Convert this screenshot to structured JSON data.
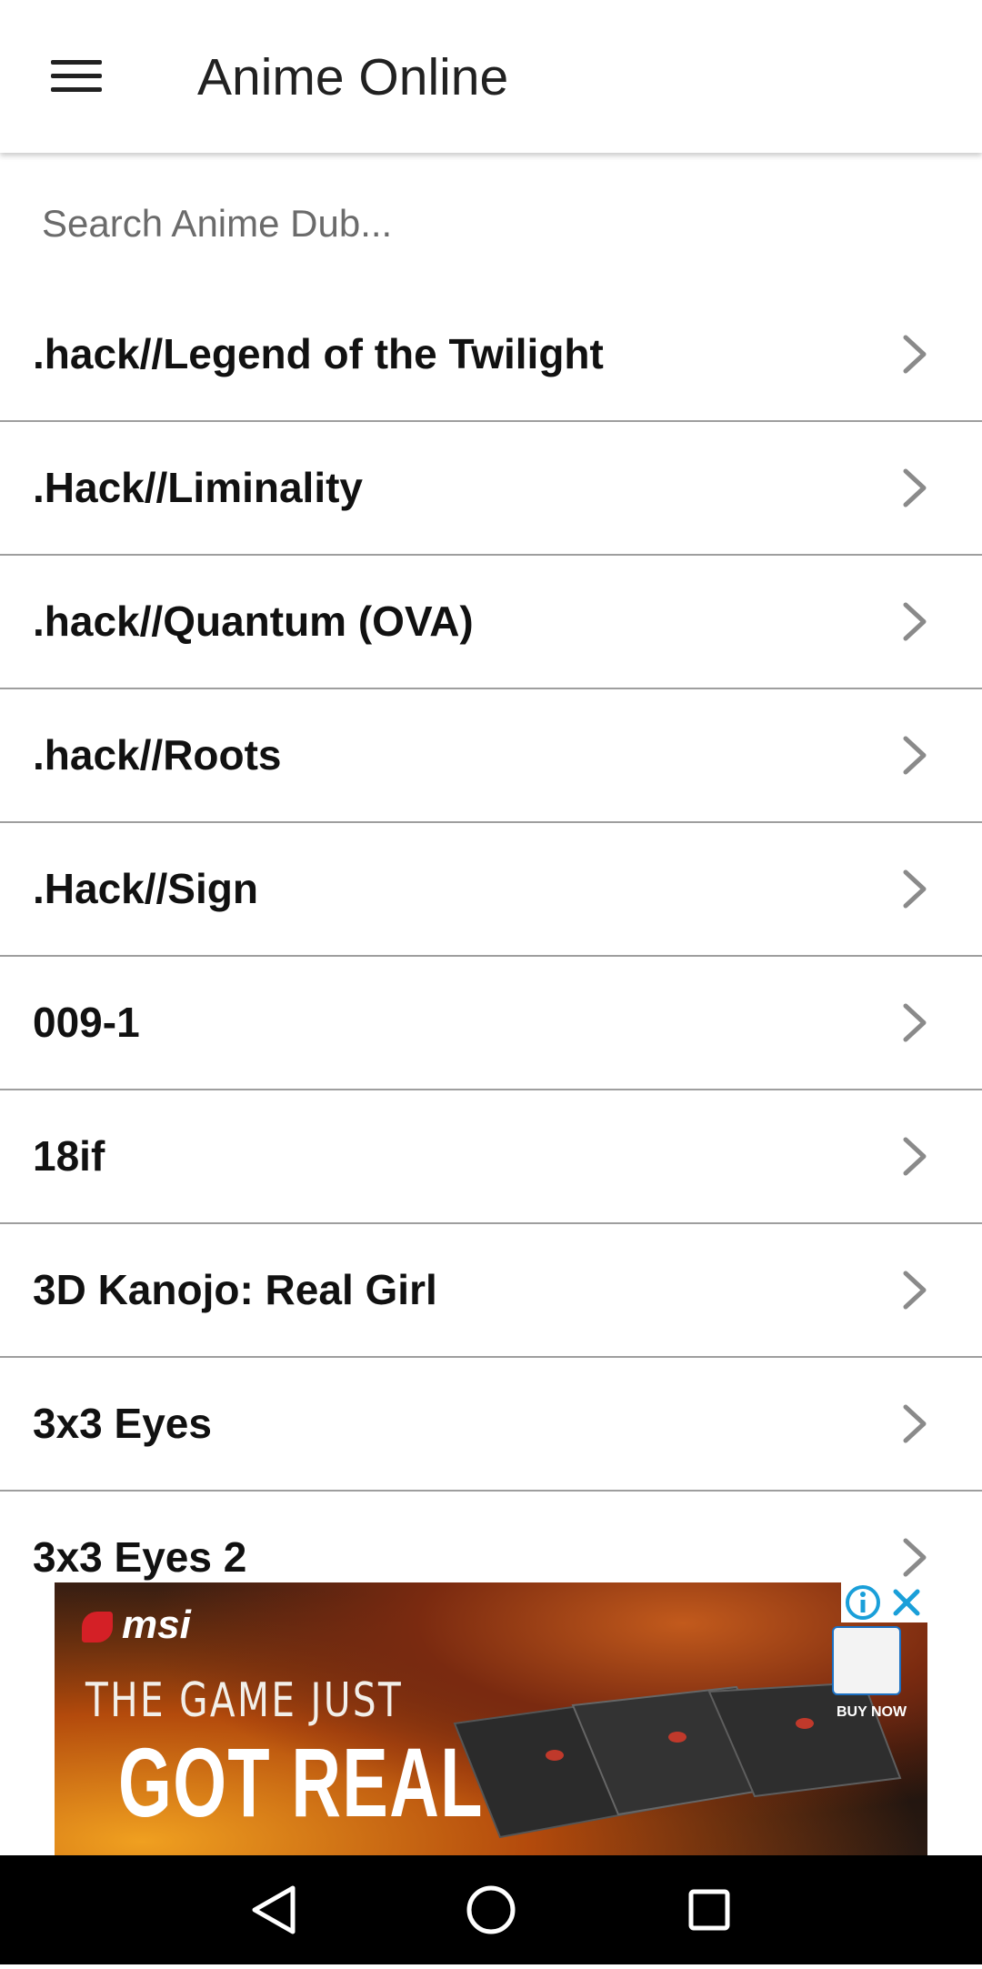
{
  "app": {
    "title": "Anime Online"
  },
  "toolbar": {
    "menu_icon": "hamburger-menu-icon"
  },
  "search": {
    "placeholder": "Search Anime Dub..."
  },
  "list": {
    "items": [
      {
        "label": ".hack//Legend of the Twilight"
      },
      {
        "label": ".Hack//Liminality"
      },
      {
        "label": ".hack//Quantum (OVA)"
      },
      {
        "label": ".hack//Roots"
      },
      {
        "label": ".Hack//Sign"
      },
      {
        "label": "009-1"
      },
      {
        "label": "18if"
      },
      {
        "label": "3D Kanojo: Real Girl"
      },
      {
        "label": "3x3 Eyes"
      },
      {
        "label": "3x3 Eyes 2"
      }
    ],
    "item_icon": "chevron-right-icon"
  },
  "ad": {
    "brand": "msi",
    "line1": "THE GAME JUST",
    "line2": "GOT REAL",
    "buy_label": "BUY NOW",
    "adchoices_icon": "info-icon",
    "close_icon": "close-icon"
  },
  "nav": {
    "back_icon": "back-triangle-icon",
    "home_icon": "home-circle-icon",
    "recents_icon": "recents-square-icon"
  },
  "colors": {
    "appbar_bg": "#ffffff",
    "text_primary": "#212121",
    "divider": "#9e9e9e",
    "navbar_bg": "#000000"
  }
}
